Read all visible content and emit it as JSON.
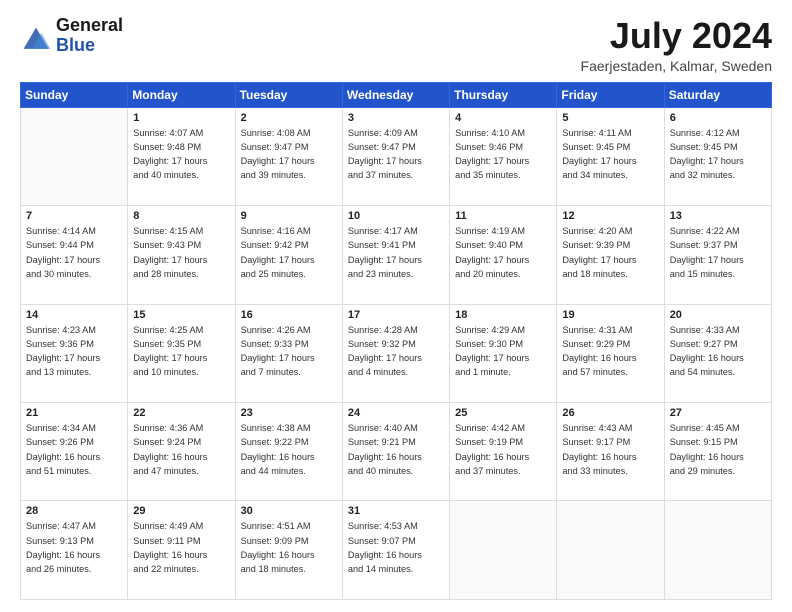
{
  "header": {
    "logo_general": "General",
    "logo_blue": "Blue",
    "month_year": "July 2024",
    "location": "Faerjestaden, Kalmar, Sweden"
  },
  "weekdays": [
    "Sunday",
    "Monday",
    "Tuesday",
    "Wednesday",
    "Thursday",
    "Friday",
    "Saturday"
  ],
  "weeks": [
    [
      {
        "day": "",
        "info": ""
      },
      {
        "day": "1",
        "info": "Sunrise: 4:07 AM\nSunset: 9:48 PM\nDaylight: 17 hours\nand 40 minutes."
      },
      {
        "day": "2",
        "info": "Sunrise: 4:08 AM\nSunset: 9:47 PM\nDaylight: 17 hours\nand 39 minutes."
      },
      {
        "day": "3",
        "info": "Sunrise: 4:09 AM\nSunset: 9:47 PM\nDaylight: 17 hours\nand 37 minutes."
      },
      {
        "day": "4",
        "info": "Sunrise: 4:10 AM\nSunset: 9:46 PM\nDaylight: 17 hours\nand 35 minutes."
      },
      {
        "day": "5",
        "info": "Sunrise: 4:11 AM\nSunset: 9:45 PM\nDaylight: 17 hours\nand 34 minutes."
      },
      {
        "day": "6",
        "info": "Sunrise: 4:12 AM\nSunset: 9:45 PM\nDaylight: 17 hours\nand 32 minutes."
      }
    ],
    [
      {
        "day": "7",
        "info": "Sunrise: 4:14 AM\nSunset: 9:44 PM\nDaylight: 17 hours\nand 30 minutes."
      },
      {
        "day": "8",
        "info": "Sunrise: 4:15 AM\nSunset: 9:43 PM\nDaylight: 17 hours\nand 28 minutes."
      },
      {
        "day": "9",
        "info": "Sunrise: 4:16 AM\nSunset: 9:42 PM\nDaylight: 17 hours\nand 25 minutes."
      },
      {
        "day": "10",
        "info": "Sunrise: 4:17 AM\nSunset: 9:41 PM\nDaylight: 17 hours\nand 23 minutes."
      },
      {
        "day": "11",
        "info": "Sunrise: 4:19 AM\nSunset: 9:40 PM\nDaylight: 17 hours\nand 20 minutes."
      },
      {
        "day": "12",
        "info": "Sunrise: 4:20 AM\nSunset: 9:39 PM\nDaylight: 17 hours\nand 18 minutes."
      },
      {
        "day": "13",
        "info": "Sunrise: 4:22 AM\nSunset: 9:37 PM\nDaylight: 17 hours\nand 15 minutes."
      }
    ],
    [
      {
        "day": "14",
        "info": "Sunrise: 4:23 AM\nSunset: 9:36 PM\nDaylight: 17 hours\nand 13 minutes."
      },
      {
        "day": "15",
        "info": "Sunrise: 4:25 AM\nSunset: 9:35 PM\nDaylight: 17 hours\nand 10 minutes."
      },
      {
        "day": "16",
        "info": "Sunrise: 4:26 AM\nSunset: 9:33 PM\nDaylight: 17 hours\nand 7 minutes."
      },
      {
        "day": "17",
        "info": "Sunrise: 4:28 AM\nSunset: 9:32 PM\nDaylight: 17 hours\nand 4 minutes."
      },
      {
        "day": "18",
        "info": "Sunrise: 4:29 AM\nSunset: 9:30 PM\nDaylight: 17 hours\nand 1 minute."
      },
      {
        "day": "19",
        "info": "Sunrise: 4:31 AM\nSunset: 9:29 PM\nDaylight: 16 hours\nand 57 minutes."
      },
      {
        "day": "20",
        "info": "Sunrise: 4:33 AM\nSunset: 9:27 PM\nDaylight: 16 hours\nand 54 minutes."
      }
    ],
    [
      {
        "day": "21",
        "info": "Sunrise: 4:34 AM\nSunset: 9:26 PM\nDaylight: 16 hours\nand 51 minutes."
      },
      {
        "day": "22",
        "info": "Sunrise: 4:36 AM\nSunset: 9:24 PM\nDaylight: 16 hours\nand 47 minutes."
      },
      {
        "day": "23",
        "info": "Sunrise: 4:38 AM\nSunset: 9:22 PM\nDaylight: 16 hours\nand 44 minutes."
      },
      {
        "day": "24",
        "info": "Sunrise: 4:40 AM\nSunset: 9:21 PM\nDaylight: 16 hours\nand 40 minutes."
      },
      {
        "day": "25",
        "info": "Sunrise: 4:42 AM\nSunset: 9:19 PM\nDaylight: 16 hours\nand 37 minutes."
      },
      {
        "day": "26",
        "info": "Sunrise: 4:43 AM\nSunset: 9:17 PM\nDaylight: 16 hours\nand 33 minutes."
      },
      {
        "day": "27",
        "info": "Sunrise: 4:45 AM\nSunset: 9:15 PM\nDaylight: 16 hours\nand 29 minutes."
      }
    ],
    [
      {
        "day": "28",
        "info": "Sunrise: 4:47 AM\nSunset: 9:13 PM\nDaylight: 16 hours\nand 26 minutes."
      },
      {
        "day": "29",
        "info": "Sunrise: 4:49 AM\nSunset: 9:11 PM\nDaylight: 16 hours\nand 22 minutes."
      },
      {
        "day": "30",
        "info": "Sunrise: 4:51 AM\nSunset: 9:09 PM\nDaylight: 16 hours\nand 18 minutes."
      },
      {
        "day": "31",
        "info": "Sunrise: 4:53 AM\nSunset: 9:07 PM\nDaylight: 16 hours\nand 14 minutes."
      },
      {
        "day": "",
        "info": ""
      },
      {
        "day": "",
        "info": ""
      },
      {
        "day": "",
        "info": ""
      }
    ]
  ]
}
